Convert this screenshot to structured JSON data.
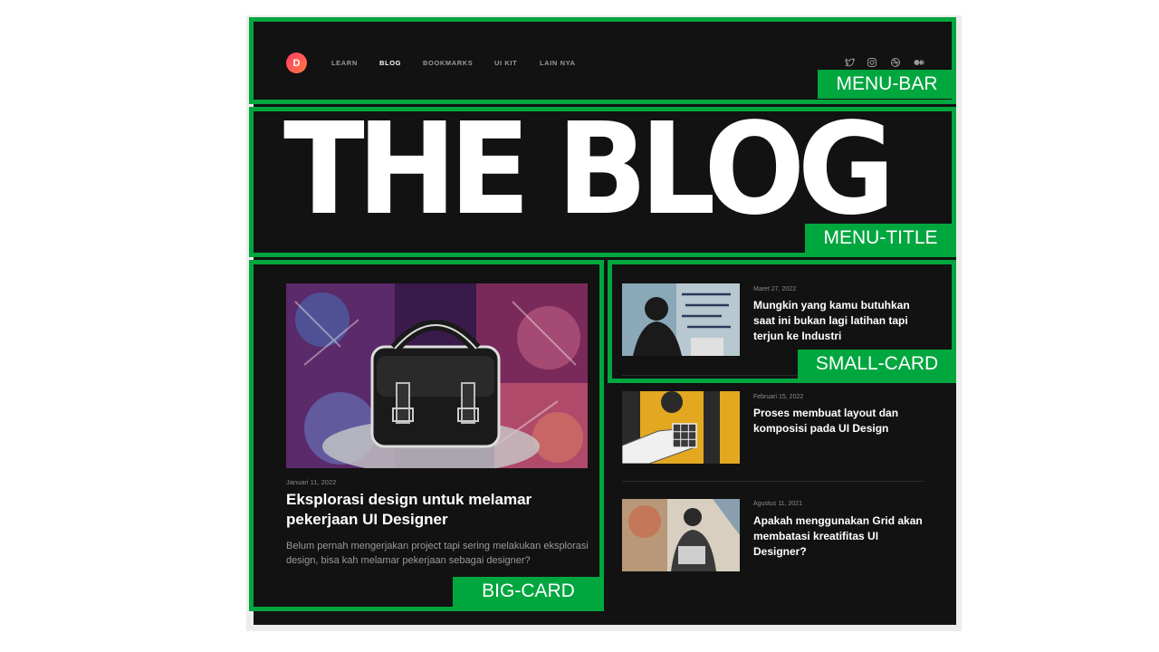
{
  "logo": {
    "letter": "D"
  },
  "nav": {
    "links": [
      {
        "label": "LEARN"
      },
      {
        "label": "BLOG"
      },
      {
        "label": "BOOKMARKS"
      },
      {
        "label": "UI KIT"
      },
      {
        "label": "LAIN NYA"
      }
    ],
    "active": "BLOG",
    "social_icons": [
      "twitter-icon",
      "instagram-icon",
      "dribbble-icon",
      "medium-icon"
    ]
  },
  "hero": {
    "title": "THE BLOG"
  },
  "big_card": {
    "date": "Januari 11, 2022",
    "title": "Eksplorasi design untuk melamar pekerjaan UI Designer",
    "description": "Belum pernah mengerjakan project tapi sering melakukan eksplorasi design, bisa kah melamar pekerjaan sebagai designer?"
  },
  "small_cards": [
    {
      "date": "Maret 27, 2022",
      "title": "Mungkin yang kamu butuhkan saat ini bukan lagi latihan tapi terjun ke Industri"
    },
    {
      "date": "Februari 15, 2022",
      "title": "Proses membuat layout dan komposisi pada UI Design"
    },
    {
      "date": "Agustus 11, 2021",
      "title": "Apakah menggunakan Grid akan membatasi kreatifitas UI Designer?"
    }
  ],
  "annotations": {
    "menu_bar": "MENU-BAR",
    "menu_title": "MENU-TITLE",
    "big_card": "BIG-CARD",
    "small_card": "SMALL-CARD"
  },
  "colors": {
    "page_background": "#121212",
    "annotation_green": "#00a63e",
    "logo_gradient_start": "#ff3b6b",
    "logo_gradient_end": "#ff7a3d"
  }
}
